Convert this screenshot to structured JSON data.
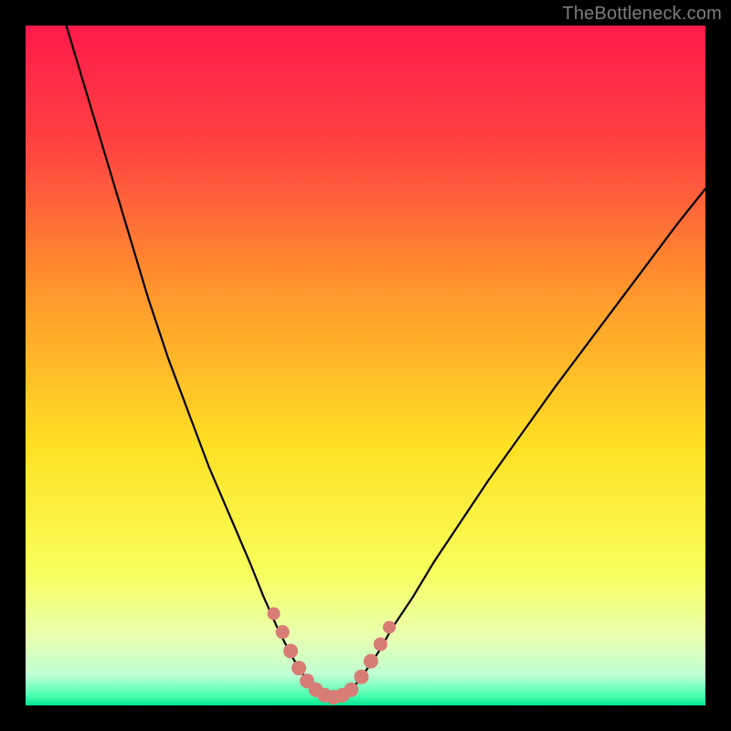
{
  "watermark": "TheBottleneck.com",
  "chart_data": {
    "type": "line",
    "title": "",
    "xlabel": "",
    "ylabel": "",
    "xlim": [
      0,
      100
    ],
    "ylim": [
      0,
      100
    ],
    "grid": false,
    "background": {
      "type": "vertical_gradient",
      "stops": [
        {
          "pos": 0.0,
          "color": "#ff1a4b"
        },
        {
          "pos": 0.18,
          "color": "#ff4441"
        },
        {
          "pos": 0.4,
          "color": "#ff9a2c"
        },
        {
          "pos": 0.62,
          "color": "#ffe024"
        },
        {
          "pos": 0.8,
          "color": "#f8ff5a"
        },
        {
          "pos": 0.9,
          "color": "#e8ffb0"
        },
        {
          "pos": 0.955,
          "color": "#bfffd4"
        },
        {
          "pos": 0.985,
          "color": "#4dffb0"
        },
        {
          "pos": 1.0,
          "color": "#00e892"
        }
      ]
    },
    "series": [
      {
        "name": "bottleneck-curve-left",
        "stroke": "#000000",
        "x": [
          6,
          9,
          12,
          15,
          18,
          21,
          24,
          27,
          30,
          33,
          35,
          37,
          39,
          40.5,
          42,
          43,
          44,
          45
        ],
        "y": [
          100,
          90,
          80,
          70,
          60,
          51,
          43,
          35,
          28,
          21,
          16,
          11.5,
          7.5,
          5,
          3,
          2,
          1.3,
          1
        ]
      },
      {
        "name": "bottleneck-curve-right",
        "stroke": "#000000",
        "x": [
          45,
          46,
          47,
          48.5,
          50,
          52,
          54,
          57,
          60,
          64,
          68,
          73,
          78,
          84,
          90,
          96,
          100
        ],
        "y": [
          1,
          1.2,
          1.8,
          3,
          5,
          8,
          11.5,
          16,
          21,
          27,
          33,
          40,
          47,
          55,
          63,
          71,
          76
        ]
      }
    ],
    "markers": [
      {
        "name": "marker-left-1",
        "x": 36.5,
        "y": 13.5,
        "r": 7,
        "color": "#d87c76"
      },
      {
        "name": "marker-left-2",
        "x": 37.8,
        "y": 10.8,
        "r": 7.5,
        "color": "#d87c76"
      },
      {
        "name": "marker-left-3",
        "x": 39.0,
        "y": 8.0,
        "r": 8,
        "color": "#d87c76"
      },
      {
        "name": "marker-left-4",
        "x": 40.2,
        "y": 5.5,
        "r": 8,
        "color": "#d87c76"
      },
      {
        "name": "marker-left-5",
        "x": 41.4,
        "y": 3.6,
        "r": 8,
        "color": "#d87c76"
      },
      {
        "name": "marker-bottom-1",
        "x": 42.7,
        "y": 2.3,
        "r": 8,
        "color": "#d87c76"
      },
      {
        "name": "marker-bottom-2",
        "x": 44.0,
        "y": 1.5,
        "r": 8,
        "color": "#d87c76"
      },
      {
        "name": "marker-bottom-3",
        "x": 45.3,
        "y": 1.2,
        "r": 8,
        "color": "#d87c76"
      },
      {
        "name": "marker-bottom-4",
        "x": 46.6,
        "y": 1.5,
        "r": 8,
        "color": "#d87c76"
      },
      {
        "name": "marker-bottom-5",
        "x": 47.9,
        "y": 2.3,
        "r": 8,
        "color": "#d87c76"
      },
      {
        "name": "marker-right-1",
        "x": 49.4,
        "y": 4.2,
        "r": 8,
        "color": "#d87c76"
      },
      {
        "name": "marker-right-2",
        "x": 50.8,
        "y": 6.5,
        "r": 8,
        "color": "#d87c76"
      },
      {
        "name": "marker-right-3",
        "x": 52.2,
        "y": 9.0,
        "r": 7.5,
        "color": "#d87c76"
      },
      {
        "name": "marker-right-4",
        "x": 53.5,
        "y": 11.5,
        "r": 7,
        "color": "#d87c76"
      }
    ]
  }
}
